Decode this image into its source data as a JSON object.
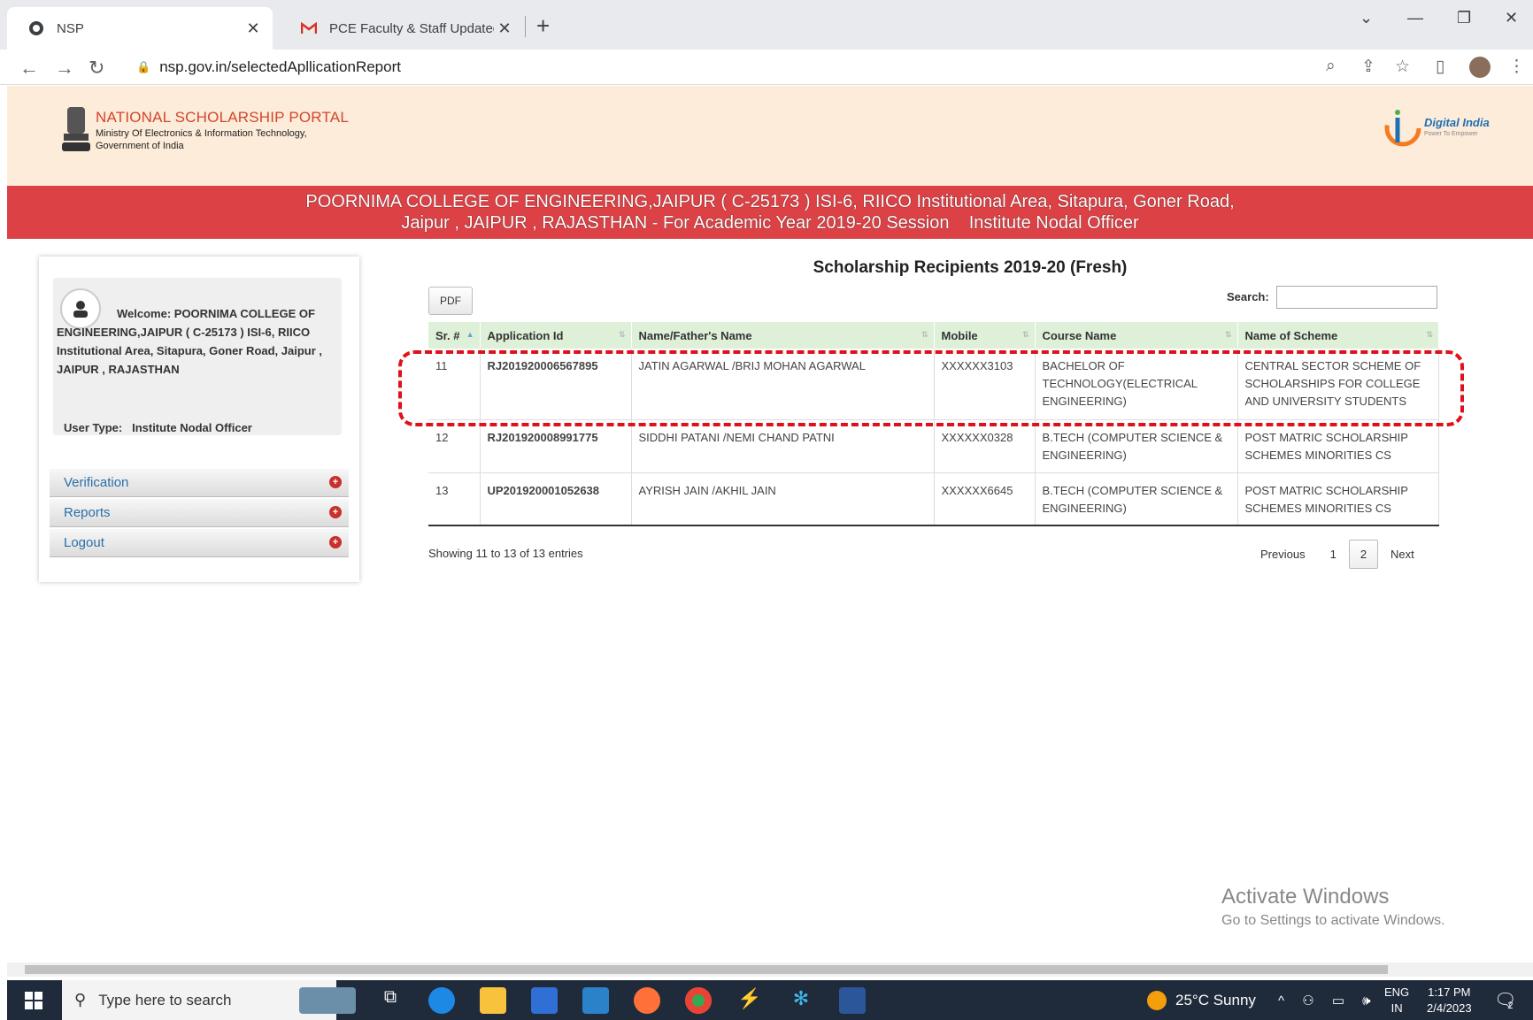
{
  "browser": {
    "tabs": [
      {
        "title": "NSP",
        "active": true
      },
      {
        "title": "PCE Faculty & Staff Updated Con",
        "active": false
      }
    ],
    "url": "nsp.gov.in/selectedApllicationReport"
  },
  "header": {
    "portal_name": "NATIONAL SCHOLARSHIP PORTAL",
    "ministry": "Ministry Of Electronics & Information Technology,",
    "government": "Government of India",
    "digital_india": "Digital India",
    "digital_india_tag": "Power To Empower"
  },
  "banner": {
    "line1": "POORNIMA COLLEGE OF ENGINEERING,JAIPUR ( C-25173 ) ISI-6, RIICO Institutional Area, Sitapura, Goner Road,",
    "line2": "Jaipur , JAIPUR , RAJASTHAN - For Academic Year 2019-20 Session    Institute Nodal Officer"
  },
  "sidebar": {
    "welcome_line1": "Welcome: POORNIMA COLLEGE OF",
    "welcome_line2": "ENGINEERING,JAIPUR ( C-25173 ) ISI-6, RIICO Institutional Area, Sitapura, Goner Road, Jaipur , JAIPUR , RAJASTHAN",
    "user_type_label": "User Type:",
    "user_type_value": "Institute Nodal Officer",
    "menu": [
      "Verification",
      "Reports",
      "Logout"
    ]
  },
  "content": {
    "title": "Scholarship Recipients 2019-20 (Fresh)",
    "pdf_label": "PDF",
    "search_label": "Search:",
    "columns": [
      "Sr. #",
      "Application Id",
      "Name/Father's Name",
      "Mobile",
      "Course Name",
      "Name of Scheme"
    ],
    "rows": [
      {
        "sr": "11",
        "app_id": "RJ201920006567895",
        "name": "JATIN AGARWAL /BRIJ MOHAN AGARWAL",
        "mobile": "XXXXXX3103",
        "course": "BACHELOR OF TECHNOLOGY(ELECTRICAL ENGINEERING)",
        "scheme": "CENTRAL SECTOR SCHEME OF SCHOLARSHIPS FOR COLLEGE AND UNIVERSITY STUDENTS"
      },
      {
        "sr": "12",
        "app_id": "RJ201920008991775",
        "name": "SIDDHI PATANI /NEMI CHAND PATNI",
        "mobile": "XXXXXX0328",
        "course": "B.TECH (COMPUTER SCIENCE & ENGINEERING)",
        "scheme": "POST MATRIC SCHOLARSHIP SCHEMES MINORITIES CS"
      },
      {
        "sr": "13",
        "app_id": "UP201920001052638",
        "name": "AYRISH JAIN /AKHIL JAIN",
        "mobile": "XXXXXX6645",
        "course": "B.TECH (COMPUTER SCIENCE & ENGINEERING)",
        "scheme": "POST MATRIC SCHOLARSHIP SCHEMES MINORITIES CS"
      }
    ],
    "showing": "Showing 11 to 13 of 13 entries",
    "pager": {
      "previous": "Previous",
      "page1": "1",
      "page2": "2",
      "next": "Next"
    }
  },
  "watermark": {
    "line1": "Activate Windows",
    "line2": "Go to Settings to activate Windows."
  },
  "taskbar": {
    "search_placeholder": "Type here to search",
    "weather": "25°C  Sunny",
    "lang1": "ENG",
    "lang2": "IN",
    "time": "1:17 PM",
    "date": "2/4/2023",
    "notif_count": "2"
  },
  "colors": {
    "header_bg": "#fdecd9",
    "banner_bg": "#dc4145",
    "table_header_bg": "#dff0d8",
    "highlight_dash": "#e0101a",
    "menu_text": "#2a6fa8"
  }
}
